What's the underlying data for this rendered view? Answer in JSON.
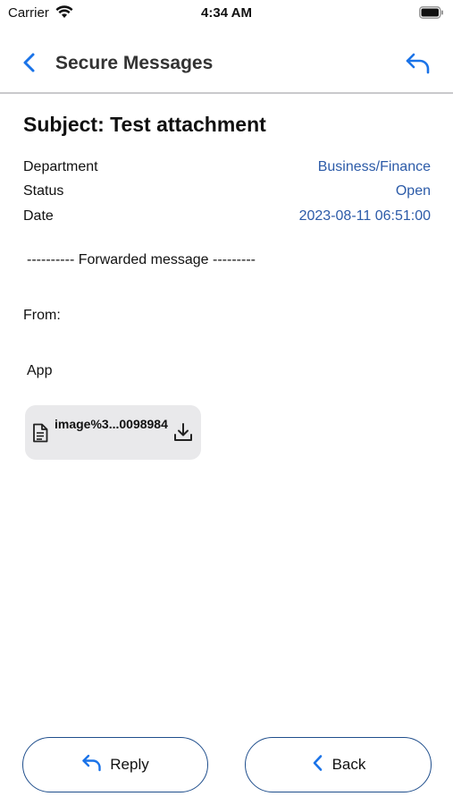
{
  "status_bar": {
    "carrier": "Carrier",
    "time": "4:34 AM"
  },
  "nav": {
    "title": "Secure Messages",
    "back_icon": "chevron-left-icon",
    "reply_icon": "reply-arrow-icon"
  },
  "message": {
    "subject": "Subject: Test attachment",
    "meta": [
      {
        "label": "Department",
        "value": "Business/Finance"
      },
      {
        "label": "Status",
        "value": "Open"
      },
      {
        "label": "Date",
        "value": "2023-08-11 06:51:00"
      }
    ],
    "forwarded_header": "---------- Forwarded message ---------",
    "from_label": "From:",
    "body_text": "App",
    "attachment": {
      "name": "image%3...0098984",
      "file_icon": "document-icon",
      "download_icon": "download-icon"
    }
  },
  "actions": {
    "reply_label": "Reply",
    "back_label": "Back"
  },
  "colors": {
    "accent": "#1a73e8",
    "link_value": "#2c5ba8",
    "button_border": "#1f4e8c",
    "attachment_bg": "#e9e9eb"
  }
}
